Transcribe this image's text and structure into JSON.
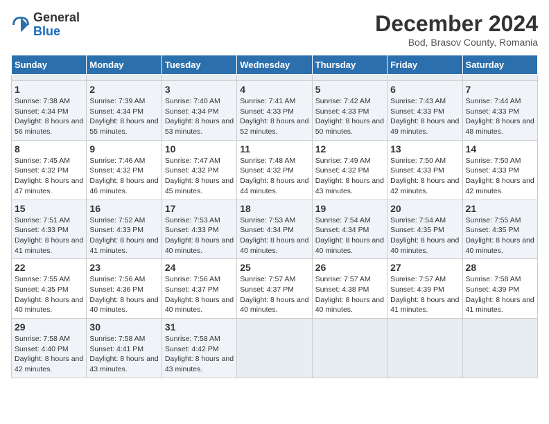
{
  "header": {
    "logo_general": "General",
    "logo_blue": "Blue",
    "title": "December 2024",
    "subtitle": "Bod, Brasov County, Romania"
  },
  "calendar": {
    "days_of_week": [
      "Sunday",
      "Monday",
      "Tuesday",
      "Wednesday",
      "Thursday",
      "Friday",
      "Saturday"
    ],
    "weeks": [
      [
        {
          "day": "",
          "empty": true
        },
        {
          "day": "",
          "empty": true
        },
        {
          "day": "",
          "empty": true
        },
        {
          "day": "",
          "empty": true
        },
        {
          "day": "",
          "empty": true
        },
        {
          "day": "",
          "empty": true
        },
        {
          "day": "",
          "empty": true
        }
      ],
      [
        {
          "day": "1",
          "sunrise": "Sunrise: 7:38 AM",
          "sunset": "Sunset: 4:34 PM",
          "daylight": "Daylight: 8 hours and 56 minutes."
        },
        {
          "day": "2",
          "sunrise": "Sunrise: 7:39 AM",
          "sunset": "Sunset: 4:34 PM",
          "daylight": "Daylight: 8 hours and 55 minutes."
        },
        {
          "day": "3",
          "sunrise": "Sunrise: 7:40 AM",
          "sunset": "Sunset: 4:34 PM",
          "daylight": "Daylight: 8 hours and 53 minutes."
        },
        {
          "day": "4",
          "sunrise": "Sunrise: 7:41 AM",
          "sunset": "Sunset: 4:33 PM",
          "daylight": "Daylight: 8 hours and 52 minutes."
        },
        {
          "day": "5",
          "sunrise": "Sunrise: 7:42 AM",
          "sunset": "Sunset: 4:33 PM",
          "daylight": "Daylight: 8 hours and 50 minutes."
        },
        {
          "day": "6",
          "sunrise": "Sunrise: 7:43 AM",
          "sunset": "Sunset: 4:33 PM",
          "daylight": "Daylight: 8 hours and 49 minutes."
        },
        {
          "day": "7",
          "sunrise": "Sunrise: 7:44 AM",
          "sunset": "Sunset: 4:33 PM",
          "daylight": "Daylight: 8 hours and 48 minutes."
        }
      ],
      [
        {
          "day": "8",
          "sunrise": "Sunrise: 7:45 AM",
          "sunset": "Sunset: 4:32 PM",
          "daylight": "Daylight: 8 hours and 47 minutes."
        },
        {
          "day": "9",
          "sunrise": "Sunrise: 7:46 AM",
          "sunset": "Sunset: 4:32 PM",
          "daylight": "Daylight: 8 hours and 46 minutes."
        },
        {
          "day": "10",
          "sunrise": "Sunrise: 7:47 AM",
          "sunset": "Sunset: 4:32 PM",
          "daylight": "Daylight: 8 hours and 45 minutes."
        },
        {
          "day": "11",
          "sunrise": "Sunrise: 7:48 AM",
          "sunset": "Sunset: 4:32 PM",
          "daylight": "Daylight: 8 hours and 44 minutes."
        },
        {
          "day": "12",
          "sunrise": "Sunrise: 7:49 AM",
          "sunset": "Sunset: 4:32 PM",
          "daylight": "Daylight: 8 hours and 43 minutes."
        },
        {
          "day": "13",
          "sunrise": "Sunrise: 7:50 AM",
          "sunset": "Sunset: 4:33 PM",
          "daylight": "Daylight: 8 hours and 42 minutes."
        },
        {
          "day": "14",
          "sunrise": "Sunrise: 7:50 AM",
          "sunset": "Sunset: 4:33 PM",
          "daylight": "Daylight: 8 hours and 42 minutes."
        }
      ],
      [
        {
          "day": "15",
          "sunrise": "Sunrise: 7:51 AM",
          "sunset": "Sunset: 4:33 PM",
          "daylight": "Daylight: 8 hours and 41 minutes."
        },
        {
          "day": "16",
          "sunrise": "Sunrise: 7:52 AM",
          "sunset": "Sunset: 4:33 PM",
          "daylight": "Daylight: 8 hours and 41 minutes."
        },
        {
          "day": "17",
          "sunrise": "Sunrise: 7:53 AM",
          "sunset": "Sunset: 4:33 PM",
          "daylight": "Daylight: 8 hours and 40 minutes."
        },
        {
          "day": "18",
          "sunrise": "Sunrise: 7:53 AM",
          "sunset": "Sunset: 4:34 PM",
          "daylight": "Daylight: 8 hours and 40 minutes."
        },
        {
          "day": "19",
          "sunrise": "Sunrise: 7:54 AM",
          "sunset": "Sunset: 4:34 PM",
          "daylight": "Daylight: 8 hours and 40 minutes."
        },
        {
          "day": "20",
          "sunrise": "Sunrise: 7:54 AM",
          "sunset": "Sunset: 4:35 PM",
          "daylight": "Daylight: 8 hours and 40 minutes."
        },
        {
          "day": "21",
          "sunrise": "Sunrise: 7:55 AM",
          "sunset": "Sunset: 4:35 PM",
          "daylight": "Daylight: 8 hours and 40 minutes."
        }
      ],
      [
        {
          "day": "22",
          "sunrise": "Sunrise: 7:55 AM",
          "sunset": "Sunset: 4:35 PM",
          "daylight": "Daylight: 8 hours and 40 minutes."
        },
        {
          "day": "23",
          "sunrise": "Sunrise: 7:56 AM",
          "sunset": "Sunset: 4:36 PM",
          "daylight": "Daylight: 8 hours and 40 minutes."
        },
        {
          "day": "24",
          "sunrise": "Sunrise: 7:56 AM",
          "sunset": "Sunset: 4:37 PM",
          "daylight": "Daylight: 8 hours and 40 minutes."
        },
        {
          "day": "25",
          "sunrise": "Sunrise: 7:57 AM",
          "sunset": "Sunset: 4:37 PM",
          "daylight": "Daylight: 8 hours and 40 minutes."
        },
        {
          "day": "26",
          "sunrise": "Sunrise: 7:57 AM",
          "sunset": "Sunset: 4:38 PM",
          "daylight": "Daylight: 8 hours and 40 minutes."
        },
        {
          "day": "27",
          "sunrise": "Sunrise: 7:57 AM",
          "sunset": "Sunset: 4:39 PM",
          "daylight": "Daylight: 8 hours and 41 minutes."
        },
        {
          "day": "28",
          "sunrise": "Sunrise: 7:58 AM",
          "sunset": "Sunset: 4:39 PM",
          "daylight": "Daylight: 8 hours and 41 minutes."
        }
      ],
      [
        {
          "day": "29",
          "sunrise": "Sunrise: 7:58 AM",
          "sunset": "Sunset: 4:40 PM",
          "daylight": "Daylight: 8 hours and 42 minutes."
        },
        {
          "day": "30",
          "sunrise": "Sunrise: 7:58 AM",
          "sunset": "Sunset: 4:41 PM",
          "daylight": "Daylight: 8 hours and 43 minutes."
        },
        {
          "day": "31",
          "sunrise": "Sunrise: 7:58 AM",
          "sunset": "Sunset: 4:42 PM",
          "daylight": "Daylight: 8 hours and 43 minutes."
        },
        {
          "day": "",
          "empty": true
        },
        {
          "day": "",
          "empty": true
        },
        {
          "day": "",
          "empty": true
        },
        {
          "day": "",
          "empty": true
        }
      ]
    ]
  }
}
